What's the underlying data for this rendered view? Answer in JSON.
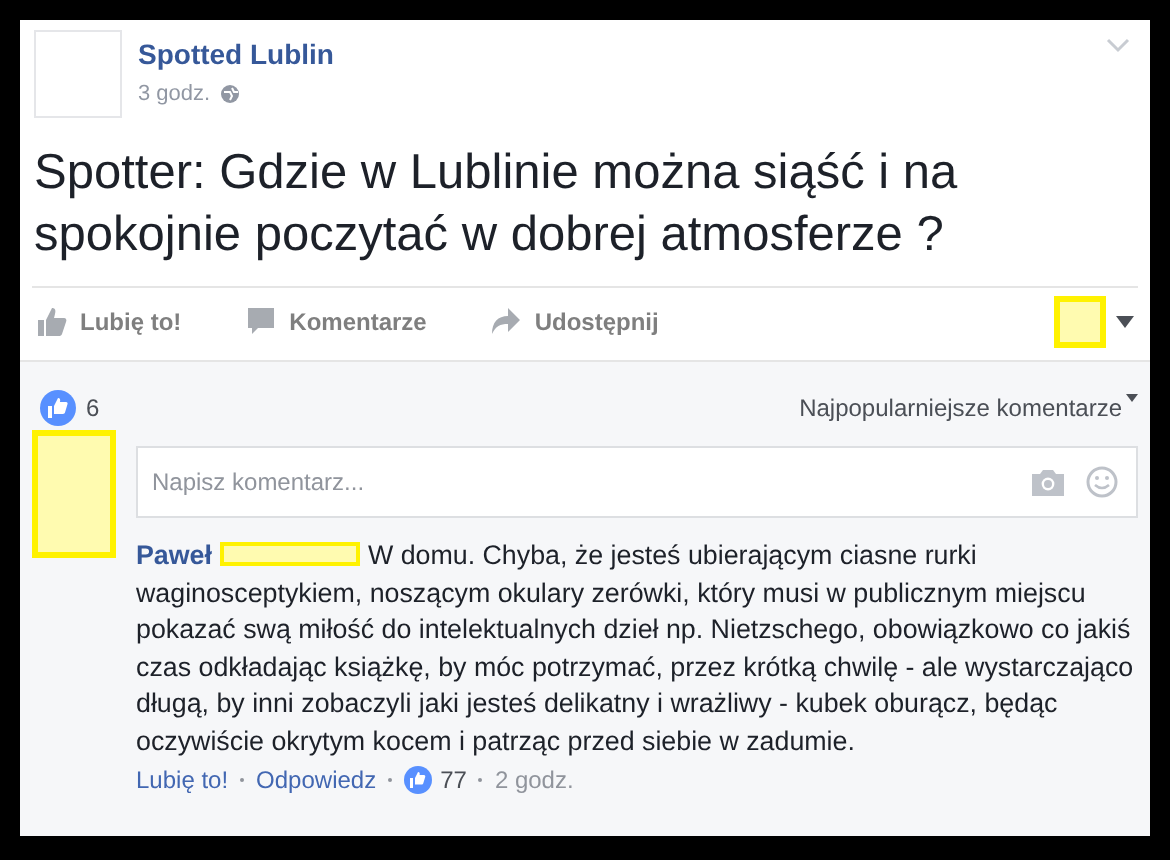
{
  "post": {
    "page_name": "Spotted Lublin",
    "time": "3 godz.",
    "text": "Spotter: Gdzie w Lublinie można siąść i na spokojnie poczytać w dobrej atmosferze ?"
  },
  "actions": [
    {
      "kind": "like",
      "label": "Lubię to!"
    },
    {
      "kind": "comment",
      "label": "Komentarze"
    },
    {
      "kind": "share",
      "label": "Udostępnij"
    }
  ],
  "reactions": {
    "count": "6",
    "sort": "Najpopularniejsze komentarze"
  },
  "comment_box": {
    "placeholder": "Napisz komentarz..."
  },
  "comments": [
    {
      "author": "Paweł",
      "text": "W domu. Chyba, że jesteś ubierającym ciasne rurki waginosceptykiem, noszącym okulary zerówki, który musi w publicznym miejscu pokazać swą miłość do intelektualnych dzieł np. Nietzschego, obowiązkowo co jakiś czas odkładając książkę, by móc potrzymać, przez krótką chwilę - ale wystarczająco długą, by inni zobaczyli jaki jesteś delikatny i wrażliwy - kubek oburącz, będąc oczywiście okrytym kocem i patrząc przed siebie w zadumie.",
      "like": "Lubię to!",
      "reply": "Odpowiedz",
      "likes": "77",
      "time": "2 godz."
    }
  ]
}
